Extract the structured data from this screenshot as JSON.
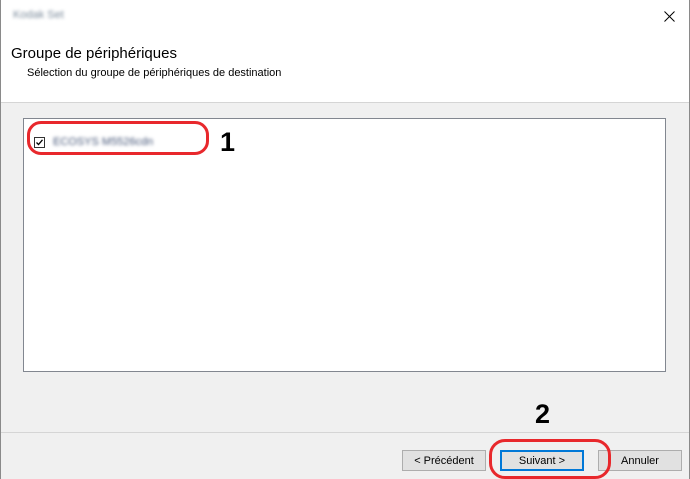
{
  "window": {
    "title": "Kodak Set"
  },
  "header": {
    "title": "Groupe de périphériques",
    "subtitle": "Sélection du groupe de périphériques de destination"
  },
  "device_list": {
    "items": [
      {
        "label": "ECOSYS M5526cdn",
        "checked": true
      }
    ]
  },
  "callouts": {
    "first": "1",
    "second": "2"
  },
  "buttons": {
    "back": "< Précédent",
    "next": "Suivant >",
    "cancel": "Annuler"
  },
  "colors": {
    "callout": "#e8282c",
    "default_button_border": "#0078d7"
  }
}
